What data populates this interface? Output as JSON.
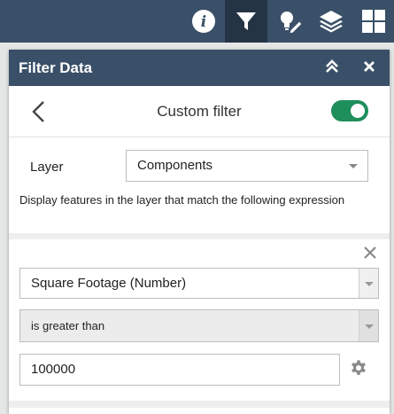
{
  "topbar": {
    "buttons": [
      {
        "name": "info-button",
        "icon": "info-icon"
      },
      {
        "name": "filter-button",
        "icon": "filter-icon",
        "active": true
      },
      {
        "name": "edit-button",
        "icon": "lightbulb-pencil-icon"
      },
      {
        "name": "layers-button",
        "icon": "layers-icon"
      },
      {
        "name": "apps-button",
        "icon": "grid-icon"
      }
    ]
  },
  "panel": {
    "title": "Filter Data",
    "collapse_icon": "double-chevron-up-icon",
    "close_icon": "close-icon"
  },
  "filter": {
    "title": "Custom filter",
    "enabled": true,
    "layer_label": "Layer",
    "layer_value": "Components",
    "description": "Display features in the layer that match the following expression",
    "field_value": "Square Footage (Number)",
    "operator_value": "is greater than",
    "value": "100000"
  },
  "colors": {
    "header": "#3a5068",
    "active_tab": "#253445",
    "toggle_on": "#1e8e5b"
  }
}
